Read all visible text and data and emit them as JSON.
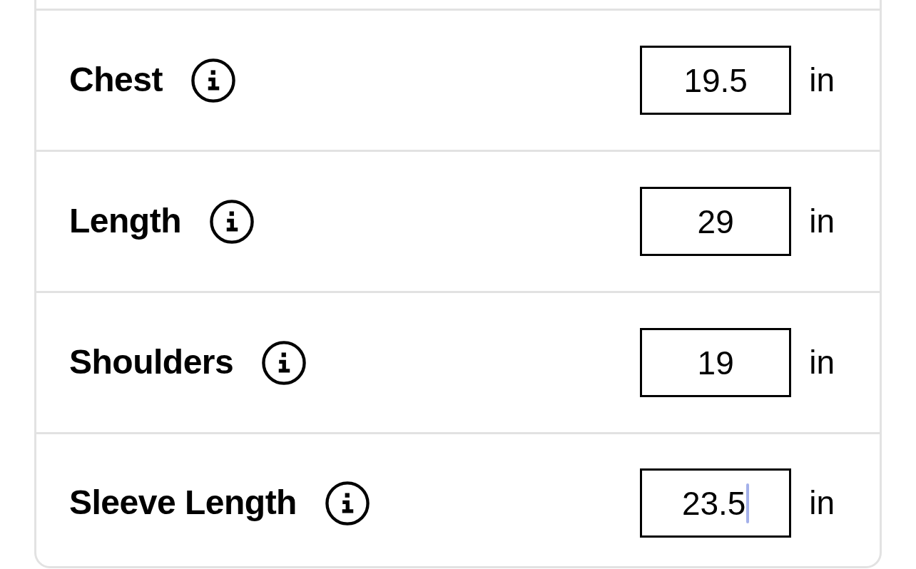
{
  "measurements": [
    {
      "label": "Chest",
      "value": "19.5",
      "unit": "in",
      "focused": false
    },
    {
      "label": "Length",
      "value": "29",
      "unit": "in",
      "focused": false
    },
    {
      "label": "Shoulders",
      "value": "19",
      "unit": "in",
      "focused": false
    },
    {
      "label": "Sleeve Length",
      "value": "23.5",
      "unit": "in",
      "focused": true
    }
  ]
}
